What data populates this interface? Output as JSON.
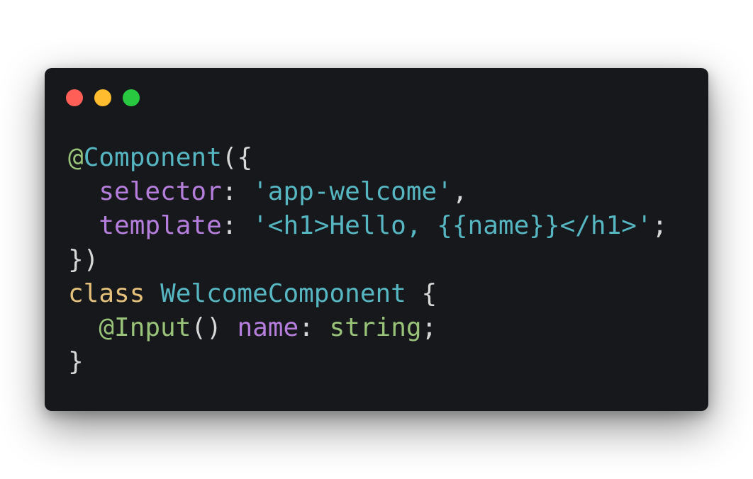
{
  "window": {
    "buttons": [
      {
        "name": "close",
        "color": "#ff5f57"
      },
      {
        "name": "minimize",
        "color": "#febc2e"
      },
      {
        "name": "maximize",
        "color": "#28c840"
      }
    ]
  },
  "colors": {
    "background": "#16181b",
    "plain": "#d7d7d7",
    "decorator": "#98c379",
    "identifier": "#56b6c2",
    "property": "#b57edc",
    "string": "#56b6c2",
    "keyword": "#e5c07b",
    "type": "#98c379"
  },
  "code": {
    "lines": [
      [
        {
          "t": "@",
          "k": "decorator"
        },
        {
          "t": "Component",
          "k": "identifier"
        },
        {
          "t": "({",
          "k": "plain"
        }
      ],
      [
        {
          "t": "  ",
          "k": "plain"
        },
        {
          "t": "selector",
          "k": "property"
        },
        {
          "t": ": ",
          "k": "plain"
        },
        {
          "t": "'app-welcome'",
          "k": "string"
        },
        {
          "t": ",",
          "k": "plain"
        }
      ],
      [
        {
          "t": "  ",
          "k": "plain"
        },
        {
          "t": "template",
          "k": "property"
        },
        {
          "t": ": ",
          "k": "plain"
        },
        {
          "t": "'<h1>Hello, {{name}}</h1>'",
          "k": "string"
        },
        {
          "t": ";",
          "k": "plain"
        }
      ],
      [
        {
          "t": "})",
          "k": "plain"
        }
      ],
      [
        {
          "t": "class",
          "k": "keyword"
        },
        {
          "t": " ",
          "k": "plain"
        },
        {
          "t": "WelcomeComponent",
          "k": "identifier"
        },
        {
          "t": " {",
          "k": "plain"
        }
      ],
      [
        {
          "t": "  ",
          "k": "plain"
        },
        {
          "t": "@Input",
          "k": "decorator"
        },
        {
          "t": "() ",
          "k": "plain"
        },
        {
          "t": "name",
          "k": "property"
        },
        {
          "t": ": ",
          "k": "plain"
        },
        {
          "t": "string",
          "k": "type"
        },
        {
          "t": ";",
          "k": "plain"
        }
      ],
      [
        {
          "t": "}",
          "k": "plain"
        }
      ]
    ]
  }
}
